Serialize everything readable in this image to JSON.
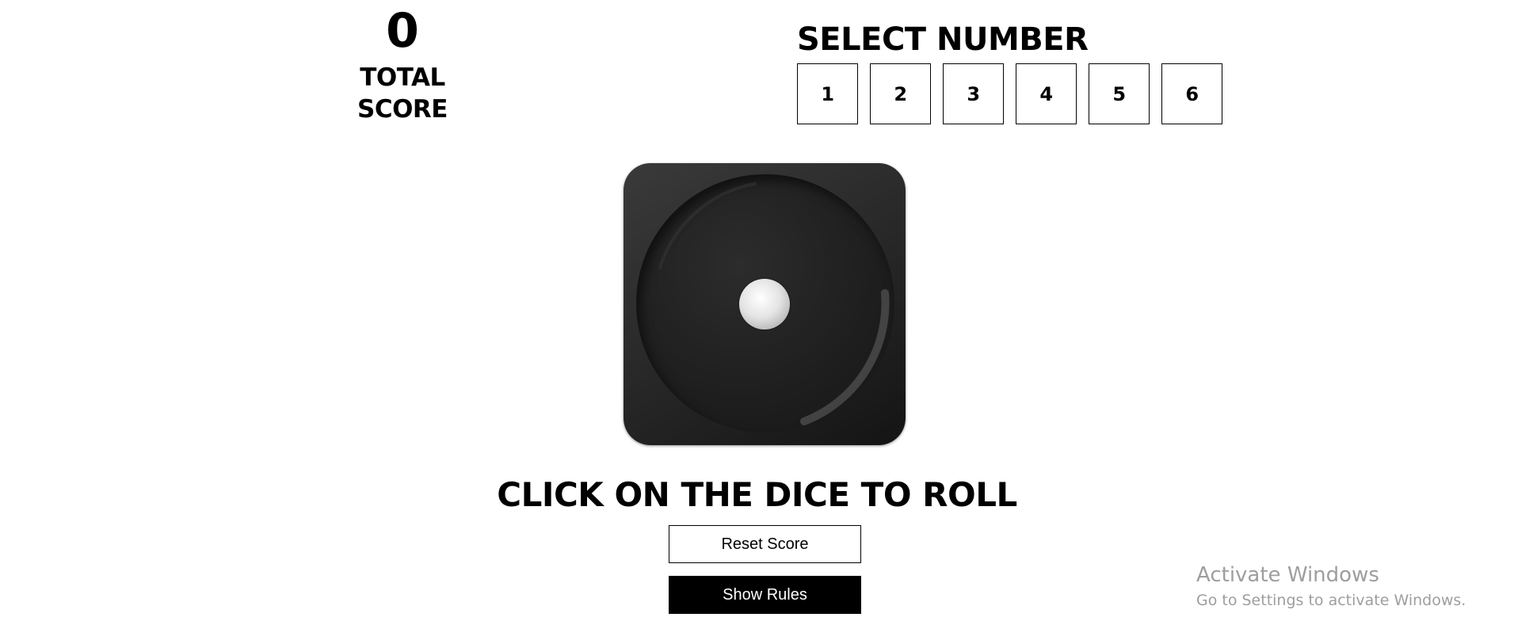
{
  "score": {
    "value": "0",
    "label": "Total Score"
  },
  "select": {
    "title": "Select Number",
    "numbers": [
      "1",
      "2",
      "3",
      "4",
      "5",
      "6"
    ]
  },
  "dice": {
    "face_value": 1,
    "icon": "dice-one-icon"
  },
  "instruction": "Click on the dice to roll",
  "buttons": {
    "reset_label": "Reset Score",
    "rules_label": "Show Rules"
  },
  "watermark": {
    "title": "Activate Windows",
    "subtitle": "Go to Settings to activate Windows."
  },
  "colors": {
    "primary": "#000000",
    "background": "#ffffff",
    "watermark": "#9e9e9e"
  }
}
